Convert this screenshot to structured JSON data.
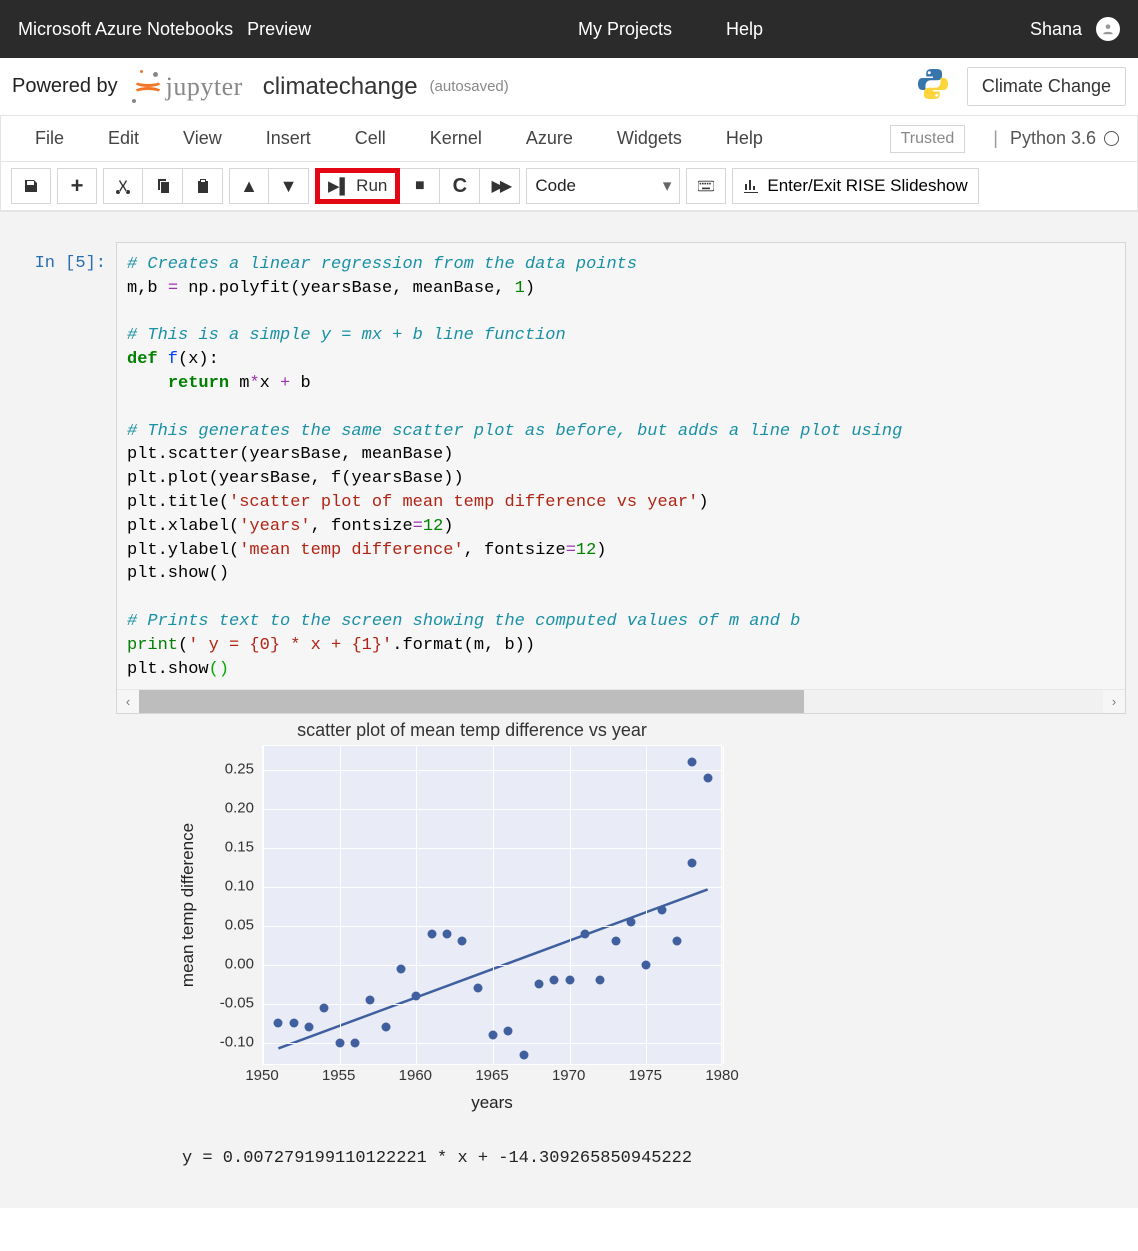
{
  "topbar": {
    "product": "Microsoft Azure Notebooks",
    "preview": "Preview",
    "nav": {
      "projects": "My Projects",
      "help": "Help"
    },
    "user": "Shana"
  },
  "header": {
    "powered_by": "Powered by",
    "jupyter": "jupyter",
    "notebook_name": "climatechange",
    "autosaved": "(autosaved)",
    "kernel_button": "Climate Change"
  },
  "menus": {
    "file": "File",
    "edit": "Edit",
    "view": "View",
    "insert": "Insert",
    "cell": "Cell",
    "kernel": "Kernel",
    "azure": "Azure",
    "widgets": "Widgets",
    "help": "Help",
    "trusted": "Trusted",
    "kernel_name": "Python 3.6"
  },
  "toolbar": {
    "run_label": "Run",
    "celltype_selected": "Code",
    "rise_label": "Enter/Exit RISE Slideshow"
  },
  "cell": {
    "prompt": "In [5]:",
    "code": {
      "c1": "# Creates a linear regression from the data points",
      "l1a": "m,b ",
      "l1b": " np.polyfit(yearsBase, meanBase, ",
      "l1num": "1",
      "l1c": ")",
      "c2": "# This is a simple y = mx + b line function",
      "l2kw": "def",
      "l2fn": " f",
      "l2rest": "(x):",
      "l3kw": "return",
      "l3a": " m",
      "l3op": "*",
      "l3b": "x ",
      "l3plus": "+",
      "l3c": " b",
      "c3": "# This generates the same scatter plot as before, but adds a line plot using",
      "l4": "plt.scatter(yearsBase, meanBase)",
      "l5": "plt.plot(yearsBase, f(yearsBase))",
      "l6a": "plt.title(",
      "l6s": "'scatter plot of mean temp difference vs year'",
      "l6b": ")",
      "l7a": "plt.xlabel(",
      "l7s": "'years'",
      "l7b": ", fontsize",
      "l7eq": "=",
      "l7n": "12",
      "l7c": ")",
      "l8a": "plt.ylabel(",
      "l8s": "'mean temp difference'",
      "l8b": ", fontsize",
      "l8eq": "=",
      "l8n": "12",
      "l8c": ")",
      "l9": "plt.show()",
      "c4": "# Prints text to the screen showing the computed values of m and b",
      "l10a": "print",
      "l10b": "(",
      "l10s": "' y = {0} * x + {1}'",
      "l10c": ".format(m, b))",
      "l11a": "plt.show",
      "l11p": "()"
    }
  },
  "output_text": " y = 0.007279199110122221 * x + -14.309265850945222",
  "chart_data": {
    "type": "scatter_with_fit_line",
    "title": "scatter plot of mean temp difference vs year",
    "xlabel": "years",
    "ylabel": "mean temp difference",
    "xlim": [
      1950,
      1980
    ],
    "ylim": [
      -0.13,
      0.28
    ],
    "xticks": [
      1950,
      1955,
      1960,
      1965,
      1970,
      1975,
      1980
    ],
    "yticks": [
      -0.1,
      -0.05,
      0.0,
      0.05,
      0.1,
      0.15,
      0.2,
      0.25
    ],
    "fit": {
      "slope": 0.007279199110122221,
      "intercept": -14.309265850945222
    },
    "points": [
      {
        "x": 1951,
        "y": -0.075
      },
      {
        "x": 1952,
        "y": -0.075
      },
      {
        "x": 1953,
        "y": -0.08
      },
      {
        "x": 1954,
        "y": -0.055
      },
      {
        "x": 1955,
        "y": -0.1
      },
      {
        "x": 1956,
        "y": -0.1
      },
      {
        "x": 1957,
        "y": -0.045
      },
      {
        "x": 1958,
        "y": -0.08
      },
      {
        "x": 1959,
        "y": -0.005
      },
      {
        "x": 1960,
        "y": -0.04
      },
      {
        "x": 1961,
        "y": 0.04
      },
      {
        "x": 1962,
        "y": 0.04
      },
      {
        "x": 1963,
        "y": 0.03
      },
      {
        "x": 1964,
        "y": -0.03
      },
      {
        "x": 1965,
        "y": -0.09
      },
      {
        "x": 1966,
        "y": -0.085
      },
      {
        "x": 1967,
        "y": -0.115
      },
      {
        "x": 1968,
        "y": -0.025
      },
      {
        "x": 1969,
        "y": -0.02
      },
      {
        "x": 1970,
        "y": -0.02
      },
      {
        "x": 1971,
        "y": 0.04
      },
      {
        "x": 1972,
        "y": -0.02
      },
      {
        "x": 1973,
        "y": 0.03
      },
      {
        "x": 1974,
        "y": 0.055
      },
      {
        "x": 1975,
        "y": 0.0
      },
      {
        "x": 1976,
        "y": 0.07
      },
      {
        "x": 1977,
        "y": 0.03
      },
      {
        "x": 1978,
        "y": 0.13
      },
      {
        "x": 1978,
        "y": 0.26
      },
      {
        "x": 1979,
        "y": 0.24
      }
    ]
  }
}
